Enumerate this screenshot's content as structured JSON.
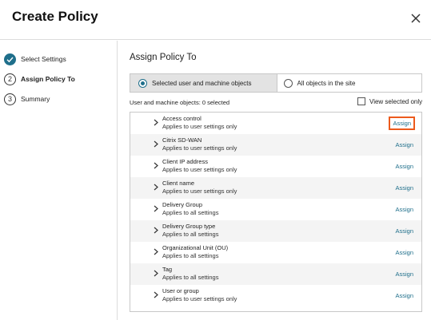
{
  "dialog": {
    "title": "Create Policy",
    "close_icon": "close-icon"
  },
  "steps": [
    {
      "number": "1",
      "label": "Select Settings",
      "state": "completed",
      "icon": "checkmark-icon"
    },
    {
      "number": "2",
      "label": "Assign Policy To",
      "state": "current"
    },
    {
      "number": "3",
      "label": "Summary",
      "state": "pending"
    }
  ],
  "main": {
    "title": "Assign Policy To",
    "scope_options": [
      {
        "label": "Selected user and machine objects",
        "selected": true
      },
      {
        "label": "All objects in the site",
        "selected": false
      }
    ],
    "count_label": "User and machine objects: 0 selected",
    "view_selected_label": "View selected only",
    "view_selected_checked": false
  },
  "objects": [
    {
      "name": "Access control",
      "applies": "Applies to user settings only",
      "action": "Assign"
    },
    {
      "name": "Citrix SD-WAN",
      "applies": "Applies to user settings only",
      "action": "Assign"
    },
    {
      "name": "Client IP address",
      "applies": "Applies to user settings only",
      "action": "Assign"
    },
    {
      "name": "Client name",
      "applies": "Applies to user settings only",
      "action": "Assign"
    },
    {
      "name": "Delivery Group",
      "applies": "Applies to all settings",
      "action": "Assign"
    },
    {
      "name": "Delivery Group type",
      "applies": "Applies to all settings",
      "action": "Assign"
    },
    {
      "name": "Organizational Unit (OU)",
      "applies": "Applies to all settings",
      "action": "Assign"
    },
    {
      "name": "Tag",
      "applies": "Applies to all settings",
      "action": "Assign"
    },
    {
      "name": "User or group",
      "applies": "Applies to user settings only",
      "action": "Assign"
    }
  ],
  "colors": {
    "accent": "#1f6f8b",
    "highlight": "#ec5a1c",
    "selected_bg": "#e3e3e3"
  }
}
